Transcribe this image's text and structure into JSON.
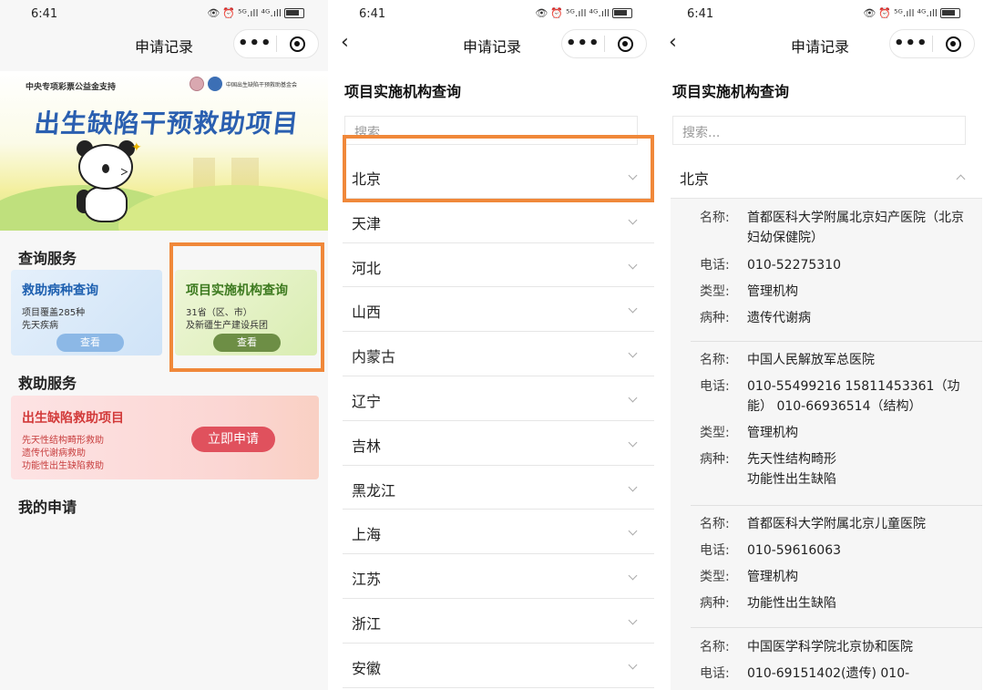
{
  "status": {
    "time": "6:41",
    "signal_a": "⁵ᴳ.ıll",
    "signal_b": "⁴ᴳ.ıll"
  },
  "navbar": {
    "title": "申请记录",
    "more": "•••",
    "back": "‹"
  },
  "panel1": {
    "banner": {
      "top_text": "中央专项彩票公益金支持",
      "logo_text": "中国出生缺陷干预救助基金会",
      "title": "出生缺陷干预救助项目"
    },
    "query_section": "查询服务",
    "card_disease": {
      "title": "救助病种查询",
      "line1": "项目覆盖285种",
      "line2": "先天疾病",
      "button": "查看"
    },
    "card_institution": {
      "title": "项目实施机构查询",
      "line1": "31省（区、市）",
      "line2": "及新疆生产建设兵团",
      "button": "查看"
    },
    "aid_section": "救助服务",
    "card_aid": {
      "title": "出生缺陷救助项目",
      "line1": "先天性结构畸形救助",
      "line2": "遗传代谢病救助",
      "line3": "功能性出生缺陷救助",
      "button": "立即申请"
    },
    "my_section": "我的申请"
  },
  "panel2": {
    "title": "项目实施机构查询",
    "search_placeholder": "搜索...",
    "provinces": [
      "北京",
      "天津",
      "河北",
      "山西",
      "内蒙古",
      "辽宁",
      "吉林",
      "黑龙江",
      "上海",
      "江苏",
      "浙江",
      "安徽"
    ]
  },
  "panel3": {
    "title": "项目实施机构查询",
    "search_placeholder": "搜索...",
    "expanded_province": "北京",
    "labels": {
      "name": "名称:",
      "phone": "电话:",
      "type": "类型:",
      "disease": "病种:"
    },
    "institutions": [
      {
        "name_l1": "首都医科大学附属北京妇产医院（北京",
        "name_l2": "妇幼保健院）",
        "phone": "010-52275310",
        "type": "管理机构",
        "disease_l1": "遗传代谢病"
      },
      {
        "name_l1": "中国人民解放军总医院",
        "phone_l1": "010-55499216 15811453361（功",
        "phone_l2": "能） 010-66936514（结构）",
        "type": "管理机构",
        "disease_l1": "先天性结构畸形",
        "disease_l2": "功能性出生缺陷"
      },
      {
        "name_l1": "首都医科大学附属北京儿童医院",
        "phone": "010-59616063",
        "type": "管理机构",
        "disease_l1": "功能性出生缺陷"
      },
      {
        "name_l1": "中国医学科学院北京协和医院",
        "phone": "010-69151402(遗传) 010-"
      }
    ]
  },
  "colors": {
    "highlight": "#f0883a",
    "blue_card": "#1e60b0",
    "green_card": "#3d7a1f",
    "red_card": "#d23a3a"
  }
}
